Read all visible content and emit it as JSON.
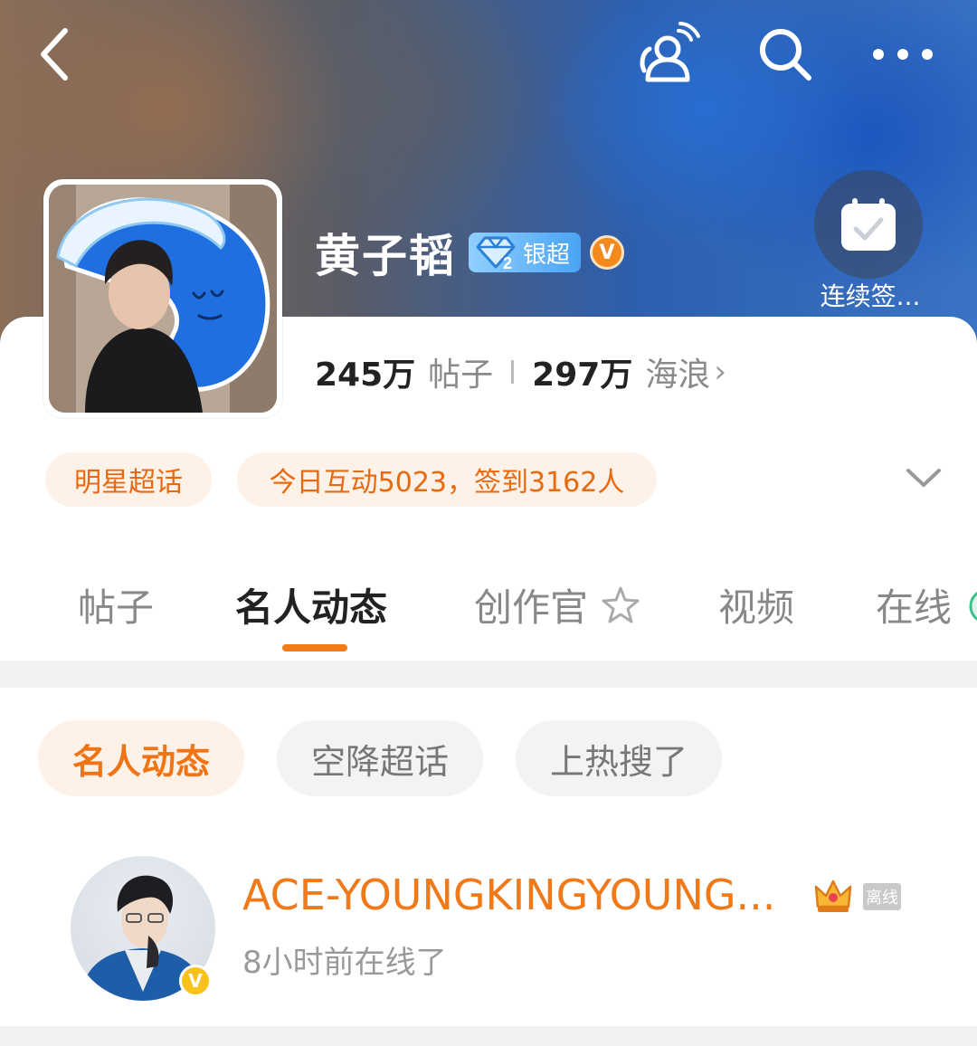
{
  "header": {
    "back_icon": "chevron-left-icon",
    "users_icon": "people-signal-icon",
    "search_icon": "search-icon",
    "more_icon": "ellipsis-icon"
  },
  "checkin": {
    "label": "连续签..."
  },
  "profile": {
    "name": "黄子韬",
    "level_badge": "银超",
    "level_number": "2",
    "verified": "V",
    "stats": [
      {
        "value": "245万",
        "label": "帖子"
      },
      {
        "value": "297万",
        "label": "海浪"
      }
    ]
  },
  "tags": {
    "category": "明星超话",
    "activity": "今日互动5023，签到3162人"
  },
  "tabs": {
    "items": [
      "帖子",
      "名人动态",
      "创作官",
      "视频",
      "在线"
    ],
    "active": "名人动态"
  },
  "filters": {
    "items": [
      "名人动态",
      "空降超话",
      "上热搜了"
    ],
    "active": "名人动态"
  },
  "feed_item": {
    "username": "ACE-YOUNGKINGYOUNG...",
    "verified": "V",
    "status_badge": "离线",
    "status_text": "8小时前在线了"
  },
  "colors": {
    "accent": "#f57b16",
    "pill_bg": "#fdf1e8",
    "divider": "#f2f2f2"
  }
}
